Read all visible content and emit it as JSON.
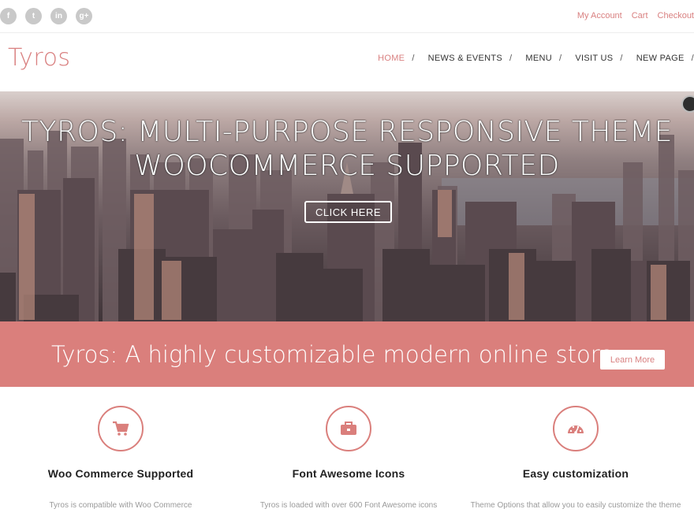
{
  "topbar": {
    "social": [
      {
        "icon": "facebook-icon",
        "glyph": "f"
      },
      {
        "icon": "twitter-icon",
        "glyph": "t"
      },
      {
        "icon": "linkedin-icon",
        "glyph": "in"
      },
      {
        "icon": "google-plus-icon",
        "glyph": "g+"
      }
    ],
    "links": [
      "My Account",
      "Cart",
      "Checkout"
    ]
  },
  "header": {
    "logo": "Tyros",
    "nav": [
      {
        "label": "HOME",
        "active": true
      },
      {
        "label": "NEWS & EVENTS",
        "active": false
      },
      {
        "label": "MENU",
        "active": false
      },
      {
        "label": "VISIT US",
        "active": false
      },
      {
        "label": "NEW PAGE",
        "active": false
      }
    ],
    "nav_separator": "/"
  },
  "hero": {
    "title_line1": "TYROS: MULTI-PURPOSE RESPONSIVE THEME",
    "title_line2": "WOOCOMMERCE SUPPORTED",
    "button": "CLICK HERE"
  },
  "banner": {
    "text": "Tyros: A highly customizable modern online store",
    "button": "Learn More"
  },
  "features": [
    {
      "icon": "shopping-cart-icon",
      "title": "Woo Commerce Supported",
      "desc": "Tyros is compatible with Woo Commerce"
    },
    {
      "icon": "briefcase-icon",
      "title": "Font Awesome Icons",
      "desc": "Tyros is loaded with over 600 Font Awesome icons"
    },
    {
      "icon": "dashboard-icon",
      "title": "Easy customization",
      "desc": "Theme Options that allow you to easily customize the theme"
    }
  ],
  "colors": {
    "accent": "#da7f7c",
    "text_dark": "#222222",
    "text_muted": "#9a9a9a"
  }
}
